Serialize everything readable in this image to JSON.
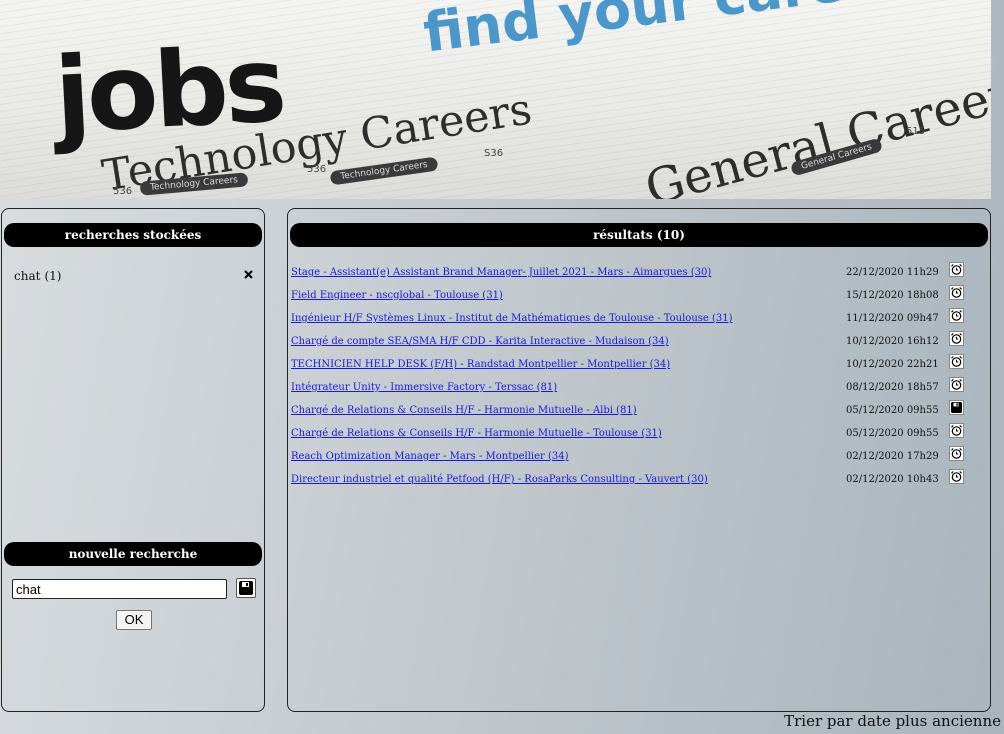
{
  "banner": {
    "headline": "jobs",
    "slogan": "find your career",
    "section_left": "Technology Careers",
    "section_right": "General Careers",
    "tag_left": "Technology Careers",
    "tag_mid": "Technology Careers",
    "tag_right": "General Careers",
    "num1": "536",
    "num2": "536",
    "num3": "S36",
    "num4": "515"
  },
  "stored": {
    "title": "recherches stockées",
    "items": [
      {
        "label": "chat",
        "count": "(1)",
        "remove_icon": "close-x-icon"
      }
    ]
  },
  "new_search": {
    "title": "nouvelle recherche",
    "input_value": "chat",
    "ok_label": "OK",
    "save_icon": "floppy-disk-icon"
  },
  "results": {
    "title": "résultats (10)",
    "rows": [
      {
        "title": "Stage - Assistant(e) Assistant Brand Manager- Juillet 2021 - Mars - Aimargues (30)",
        "date": "22/12/2020 11h29",
        "icon": "alarm-clock-icon"
      },
      {
        "title": "Field Engineer - nscglobal - Toulouse (31)",
        "date": "15/12/2020 18h08",
        "icon": "alarm-clock-icon"
      },
      {
        "title": "Ingénieur H/F Systèmes Linux - Institut de Mathématiques de Toulouse - Toulouse (31)",
        "date": "11/12/2020 09h47",
        "icon": "alarm-clock-icon"
      },
      {
        "title": "Chargé de compte SEA/SMA H/F CDD - Karita Interactive - Mudaison (34)",
        "date": "10/12/2020 16h12",
        "icon": "alarm-clock-icon"
      },
      {
        "title": "TECHNICIEN HELP DESK (F/H) - Randstad Montpellier - Montpellier (34)",
        "date": "10/12/2020 22h21",
        "icon": "alarm-clock-icon"
      },
      {
        "title": "Intégrateur Unity - Immersive Factory - Terssac (81)",
        "date": "08/12/2020 18h57",
        "icon": "alarm-clock-icon"
      },
      {
        "title": "Chargé de Relations & Conseils H/F - Harmonie Mutuelle - Albi (81)",
        "date": "05/12/2020 09h55",
        "icon": "floppy-disk-icon"
      },
      {
        "title": "Chargé de Relations & Conseils H/F - Harmonie Mutuelle - Toulouse (31)",
        "date": "05/12/2020 09h55",
        "icon": "alarm-clock-icon"
      },
      {
        "title": "Reach Optimization Manager - Mars - Montpellier (34)",
        "date": "02/12/2020 17h29",
        "icon": "alarm-clock-icon"
      },
      {
        "title": "Directeur industriel et qualité Petfood (H/F) - RosaParks Consulting - Vauvert (30)",
        "date": "02/12/2020 10h43",
        "icon": "alarm-clock-icon"
      }
    ]
  },
  "sort": {
    "label": "Trier par date plus ancienne"
  }
}
